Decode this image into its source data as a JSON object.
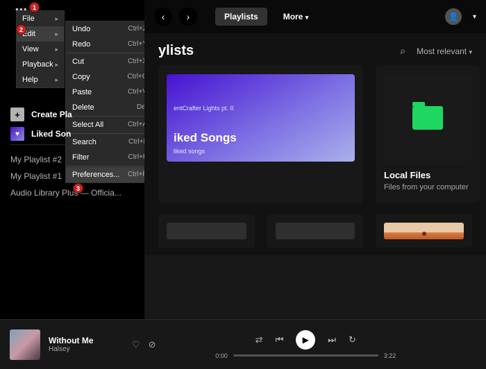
{
  "menu_dots": "•••",
  "main_menu": {
    "file": "File",
    "edit": "Edit",
    "view": "View",
    "playback": "Playback",
    "help": "Help"
  },
  "submenu": {
    "undo": {
      "l": "Undo",
      "s": "Ctrl+Z"
    },
    "redo": {
      "l": "Redo",
      "s": "Ctrl+Y"
    },
    "cut": {
      "l": "Cut",
      "s": "Ctrl+X"
    },
    "copy": {
      "l": "Copy",
      "s": "Ctrl+C"
    },
    "paste": {
      "l": "Paste",
      "s": "Ctrl+V"
    },
    "delete": {
      "l": "Delete",
      "s": "Del"
    },
    "select_all": {
      "l": "Select All",
      "s": "Ctrl+A"
    },
    "search": {
      "l": "Search",
      "s": "Ctrl+L"
    },
    "filter": {
      "l": "Filter",
      "s": "Ctrl+F"
    },
    "preferences": {
      "l": "Preferences...",
      "s": "Ctrl+P"
    }
  },
  "badges": {
    "b1": "1",
    "b2": "2",
    "b3": "3"
  },
  "sidebar": {
    "create_playlist": "Create Pla",
    "liked_songs": "Liked Son",
    "playlists": [
      "My Playlist #2",
      "My Playlist #1",
      "Audio Library Plus — Officia..."
    ]
  },
  "topbar": {
    "playlists": "Playlists",
    "more": "More"
  },
  "header": {
    "title": "ylists",
    "sort": "Most relevant"
  },
  "cards": {
    "liked": {
      "tiny": "entCrafter Lights pt. II",
      "big": "iked Songs",
      "small": "liked songs"
    },
    "local": {
      "title": "Local Files",
      "sub": "Files from your computer"
    }
  },
  "player": {
    "title": "Without Me",
    "artist": "Halsey",
    "elapsed": "0:00",
    "total": "3:22"
  }
}
